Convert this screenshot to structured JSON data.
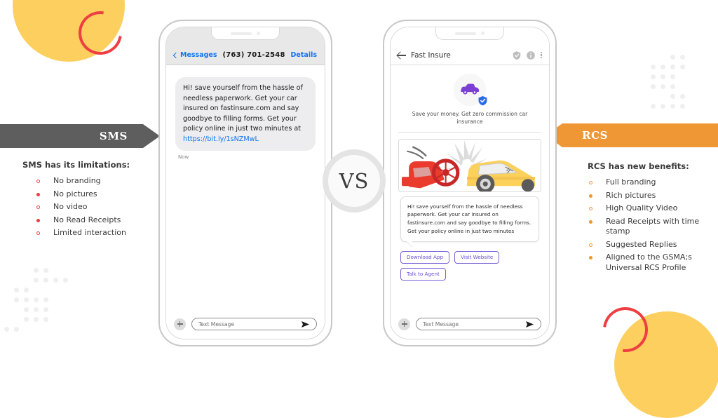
{
  "decor": {
    "yellow": "#FCCF5F",
    "red": "#EF3E42",
    "dot": "#EFEFEF"
  },
  "vs_badge": {
    "label": "VS"
  },
  "sms_side": {
    "banner_label": "SMS",
    "banner_color": "#5E5E5E",
    "heading": "SMS has its limitations:",
    "bullets": [
      {
        "text": "No branding",
        "style": "open"
      },
      {
        "text": "No pictures",
        "style": "fill"
      },
      {
        "text": "No video",
        "style": "open"
      },
      {
        "text": "No Read Receipts",
        "style": "fill"
      },
      {
        "text": "Limited interaction",
        "style": "open"
      }
    ]
  },
  "rcs_side": {
    "banner_label": "RCS",
    "banner_color": "#EF9734",
    "heading": "RCS has new benefits:",
    "bullets": [
      {
        "text": "Full branding",
        "style": "open"
      },
      {
        "text": "Rich pictures",
        "style": "fill"
      },
      {
        "text": "High Quality Video",
        "style": "open"
      },
      {
        "text": "Read Receipts with time stamp",
        "style": "fill"
      },
      {
        "text": "Suggested Replies",
        "style": "open"
      },
      {
        "text": "Aligned to the GSMA;s Universal RCS Profile",
        "style": "fill"
      }
    ]
  },
  "sms_phone": {
    "header": {
      "back_label": "Messages",
      "title": "(763) 701-2548",
      "details_label": "Details",
      "accent": "#1273F0"
    },
    "message": {
      "text": "Hi! save yourself from the hassle of needless paperwork. Get your car insured on fastinsure.com and say goodbye to filling forms. Get your policy online in just two minutes at ",
      "link": "https://bit.ly/1sNZMwL",
      "timestamp": "Now"
    },
    "input": {
      "placeholder": "Text Message",
      "plus_icon": "plus-icon",
      "send_icon": "send-icon"
    }
  },
  "rcs_phone": {
    "header": {
      "back_icon": "back-arrow-icon",
      "title": "Fast Insure",
      "verified_icon": "verified-shield-icon",
      "info_icon": "info-icon",
      "menu_icon": "kebab-menu-icon"
    },
    "card": {
      "avatar_icon": "car-avatar-icon",
      "verified_badge_icon": "verified-badge-icon",
      "caption": "Save your money. Get zero commission car insurance",
      "media_icon": "car-motorcycle-crash-illustration"
    },
    "message": {
      "text": "Hi! save yourself from the hassle of needless paperwork. Get your car insured on fastinsure.com and say goodbye to filling forms. Get your policy online in just two minutes"
    },
    "chips": [
      {
        "label": "Download App"
      },
      {
        "label": "Visit Website"
      },
      {
        "label": "Talk to Agent"
      }
    ],
    "chip_color": "#6B4FD0",
    "input": {
      "placeholder": "Text Message",
      "plus_icon": "plus-icon",
      "send_icon": "send-icon"
    }
  }
}
